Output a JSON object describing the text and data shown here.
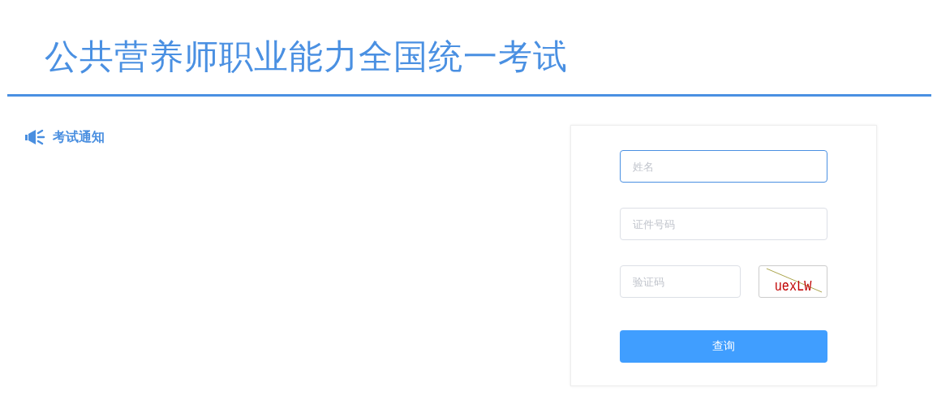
{
  "header": {
    "title": "公共营养师职业能力全国统一考试"
  },
  "notice": {
    "label": "考试通知"
  },
  "form": {
    "fields": [
      {
        "kind": "text",
        "placeholder": "姓名",
        "focused": true
      },
      {
        "kind": "text",
        "placeholder": "证件号码",
        "focused": false
      },
      {
        "kind": "captcha",
        "placeholder": "验证码",
        "focused": false,
        "captcha_text": "uexLW"
      }
    ],
    "submit": "查询"
  }
}
